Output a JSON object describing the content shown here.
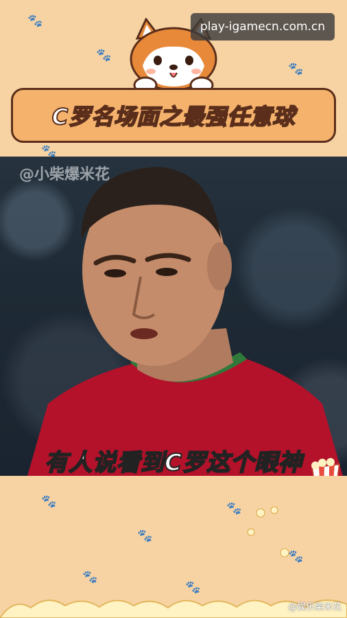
{
  "badge": {
    "url": "play-igamecn.com.cn"
  },
  "banner": {
    "title": "C罗名场面之最强任意球"
  },
  "video": {
    "watermark": "@小柴爆米花",
    "caption": "有人说看到C罗这个眼神"
  },
  "footer": {
    "watermark": "@娱乐柴米花"
  },
  "colors": {
    "background": "#f7d3a4",
    "banner_fill": "#f4b26d",
    "banner_border": "#5a2e1a",
    "jersey": "#b3122a",
    "collar": "#2f7a3a"
  }
}
